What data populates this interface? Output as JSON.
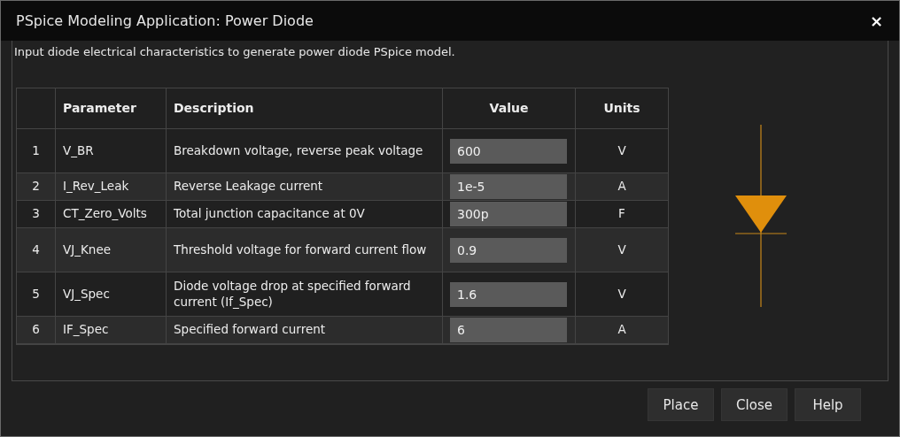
{
  "window": {
    "title": "PSpice Modeling Application: Power Diode",
    "close": "×"
  },
  "intro": "Input diode electrical characteristics to generate power diode PSpice model.",
  "table": {
    "columns": [
      "Parameter",
      "Description",
      "Value",
      "Units"
    ],
    "rows": [
      {
        "index": "1",
        "parameter": "V_BR",
        "description": "Breakdown voltage, reverse peak voltage",
        "value": "600",
        "units": "V"
      },
      {
        "index": "2",
        "parameter": "I_Rev_Leak",
        "description": "Reverse Leakage current",
        "value": "1e-5",
        "units": "A"
      },
      {
        "index": "3",
        "parameter": "CT_Zero_Volts",
        "description": "Total junction capacitance at 0V",
        "value": "300p",
        "units": "F"
      },
      {
        "index": "4",
        "parameter": "VJ_Knee",
        "description": "Threshold voltage for forward current flow",
        "value": "0.9",
        "units": "V"
      },
      {
        "index": "5",
        "parameter": "VJ_Spec",
        "description": "Diode voltage drop at specified forward current (If_Spec)",
        "value": "1.6",
        "units": "V"
      },
      {
        "index": "6",
        "parameter": "IF_Spec",
        "description": "Specified forward current",
        "value": "6",
        "units": "A"
      }
    ]
  },
  "buttons": [
    "Place",
    "Close",
    "Help"
  ]
}
